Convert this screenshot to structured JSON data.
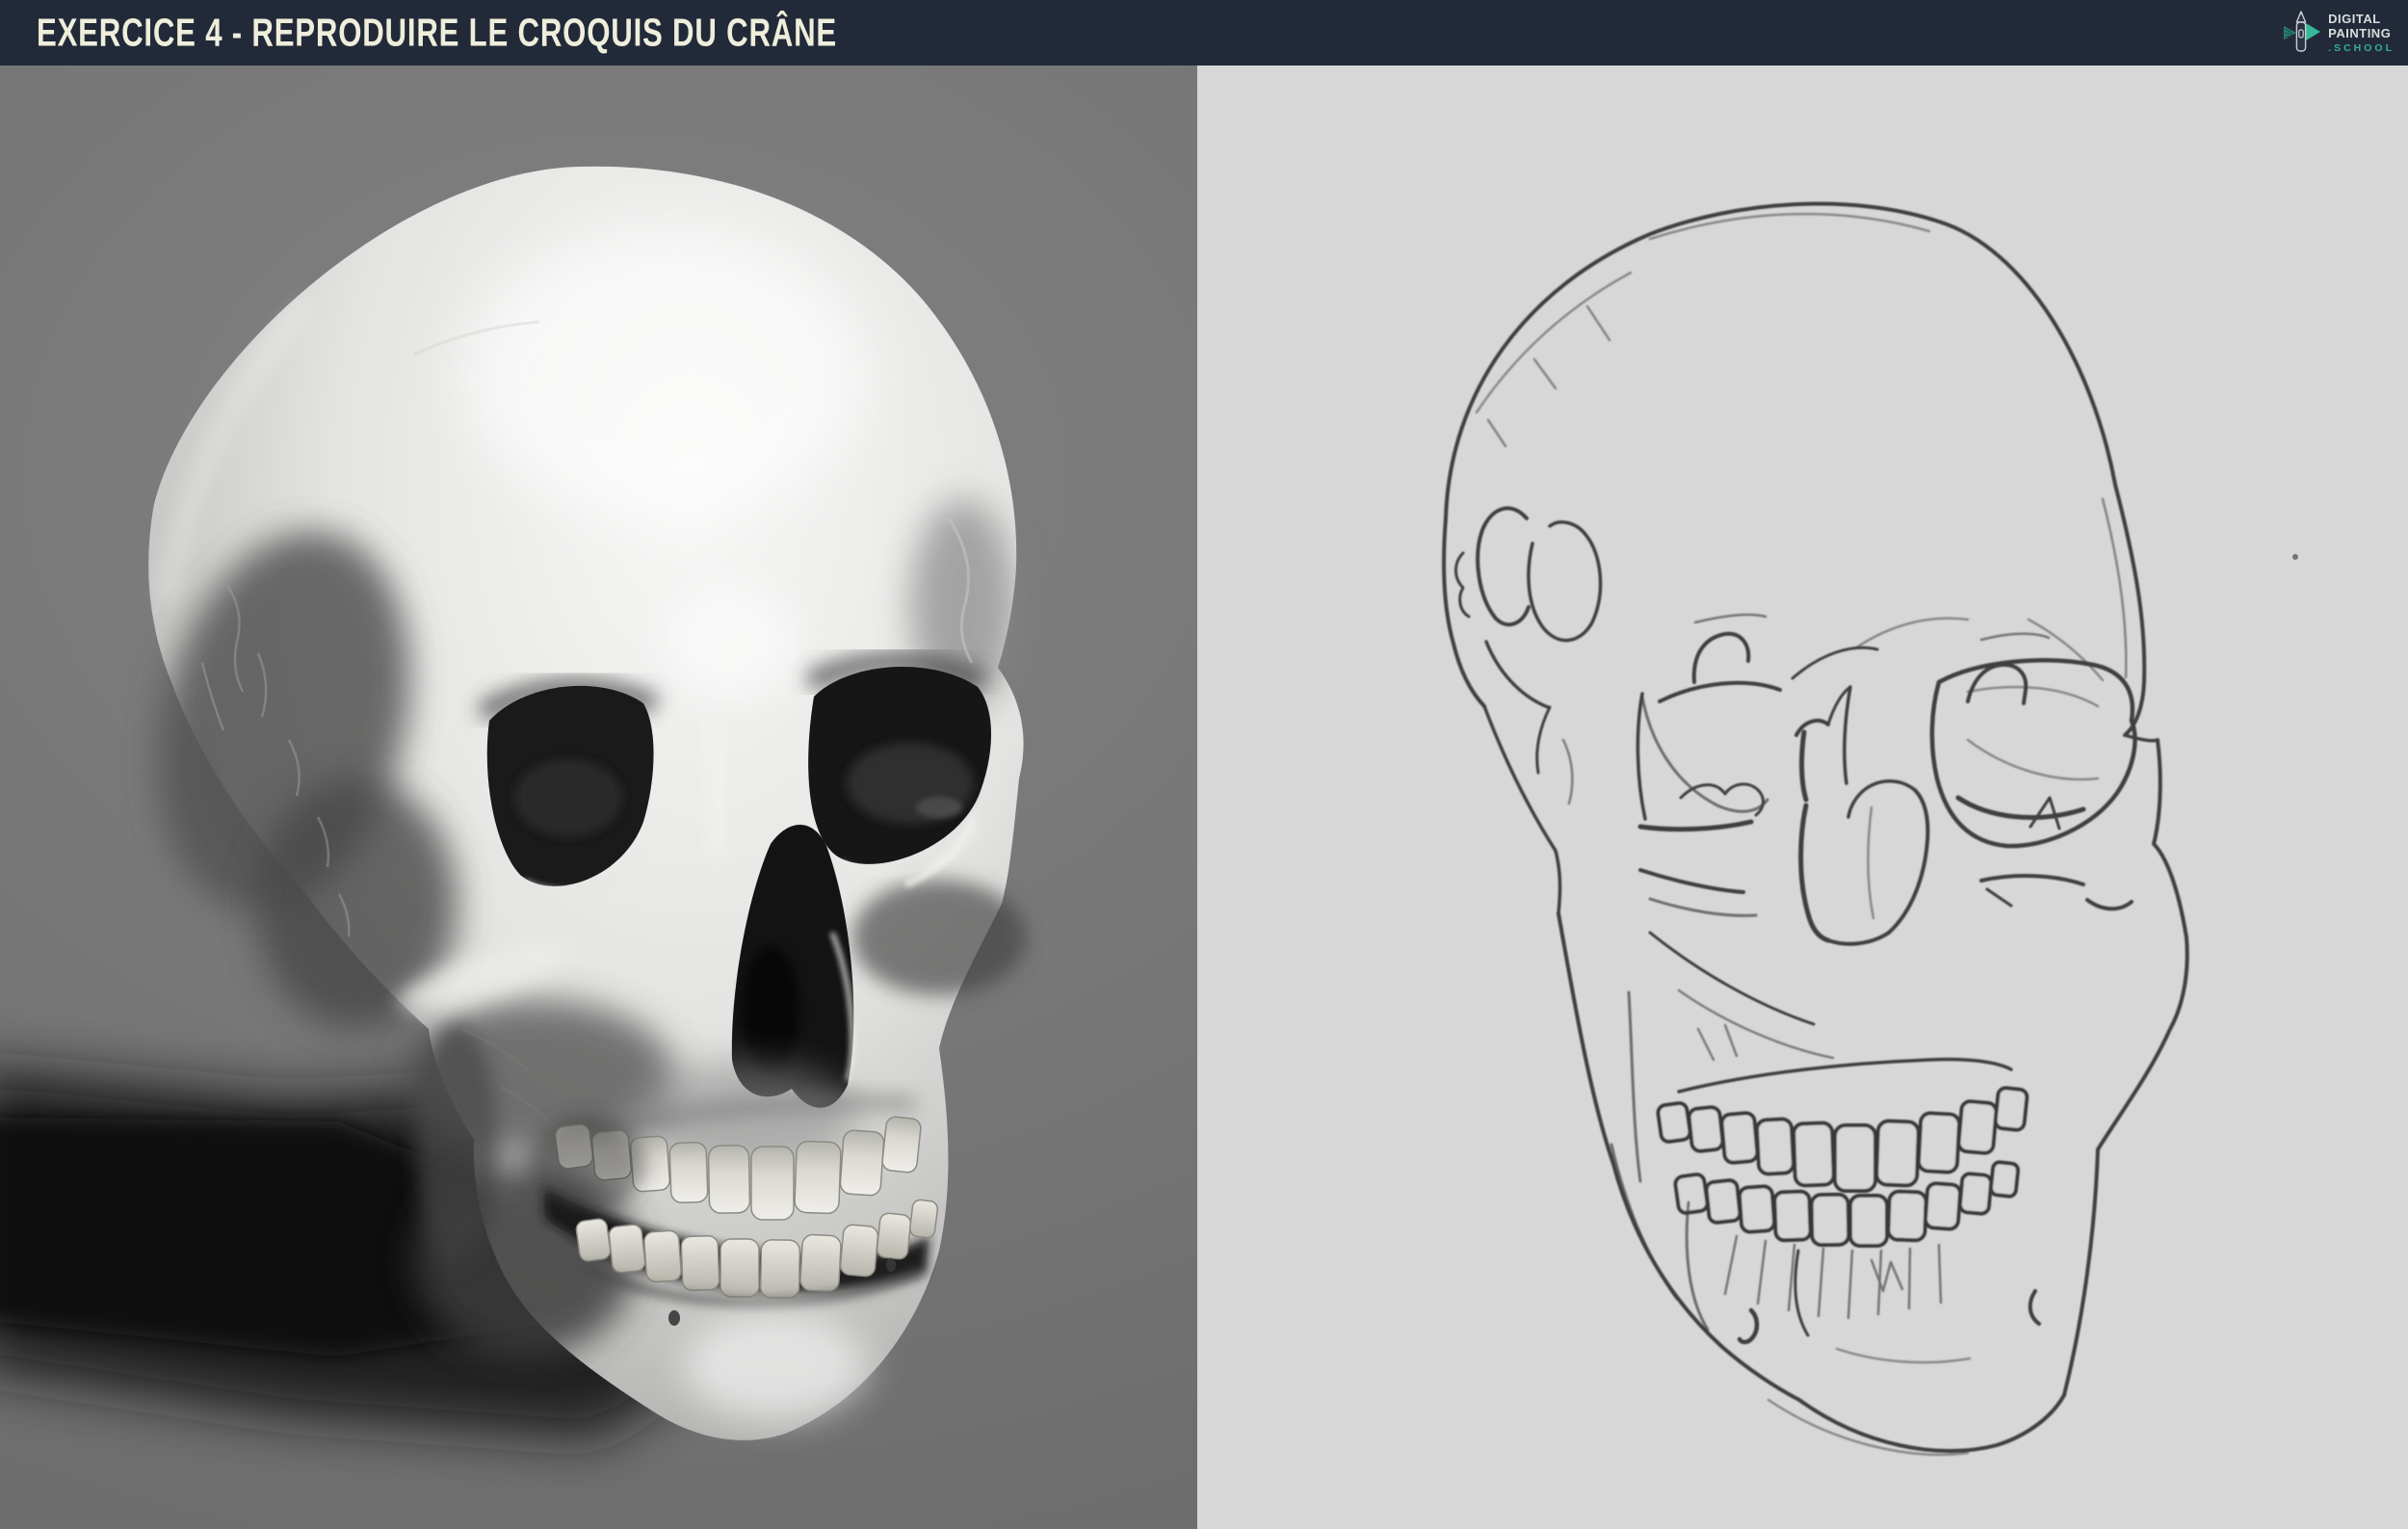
{
  "header": {
    "title": "EXERCICE 4 - REPRODUIRE LE CROQUIS DU CRÂNE"
  },
  "logo": {
    "word1": "DIGITAL",
    "word2": "PAINTING",
    "word3": ".SCHOOL",
    "icon": "stylus-pencil-icon"
  },
  "colors": {
    "header_bg": "#222a39",
    "header_text": "#eeeedb",
    "logo_text": "#d9dddd",
    "logo_accent": "#35ad93",
    "left_panel_bg": "#787878",
    "right_panel_bg": "#d6d7d6"
  },
  "panels": {
    "left": {
      "content": "Grayscale 3D render of a human skull, three-quarter view, cast shadow to lower left"
    },
    "right": {
      "content": "Pencil line sketch of the same skull on light gray paper"
    }
  }
}
